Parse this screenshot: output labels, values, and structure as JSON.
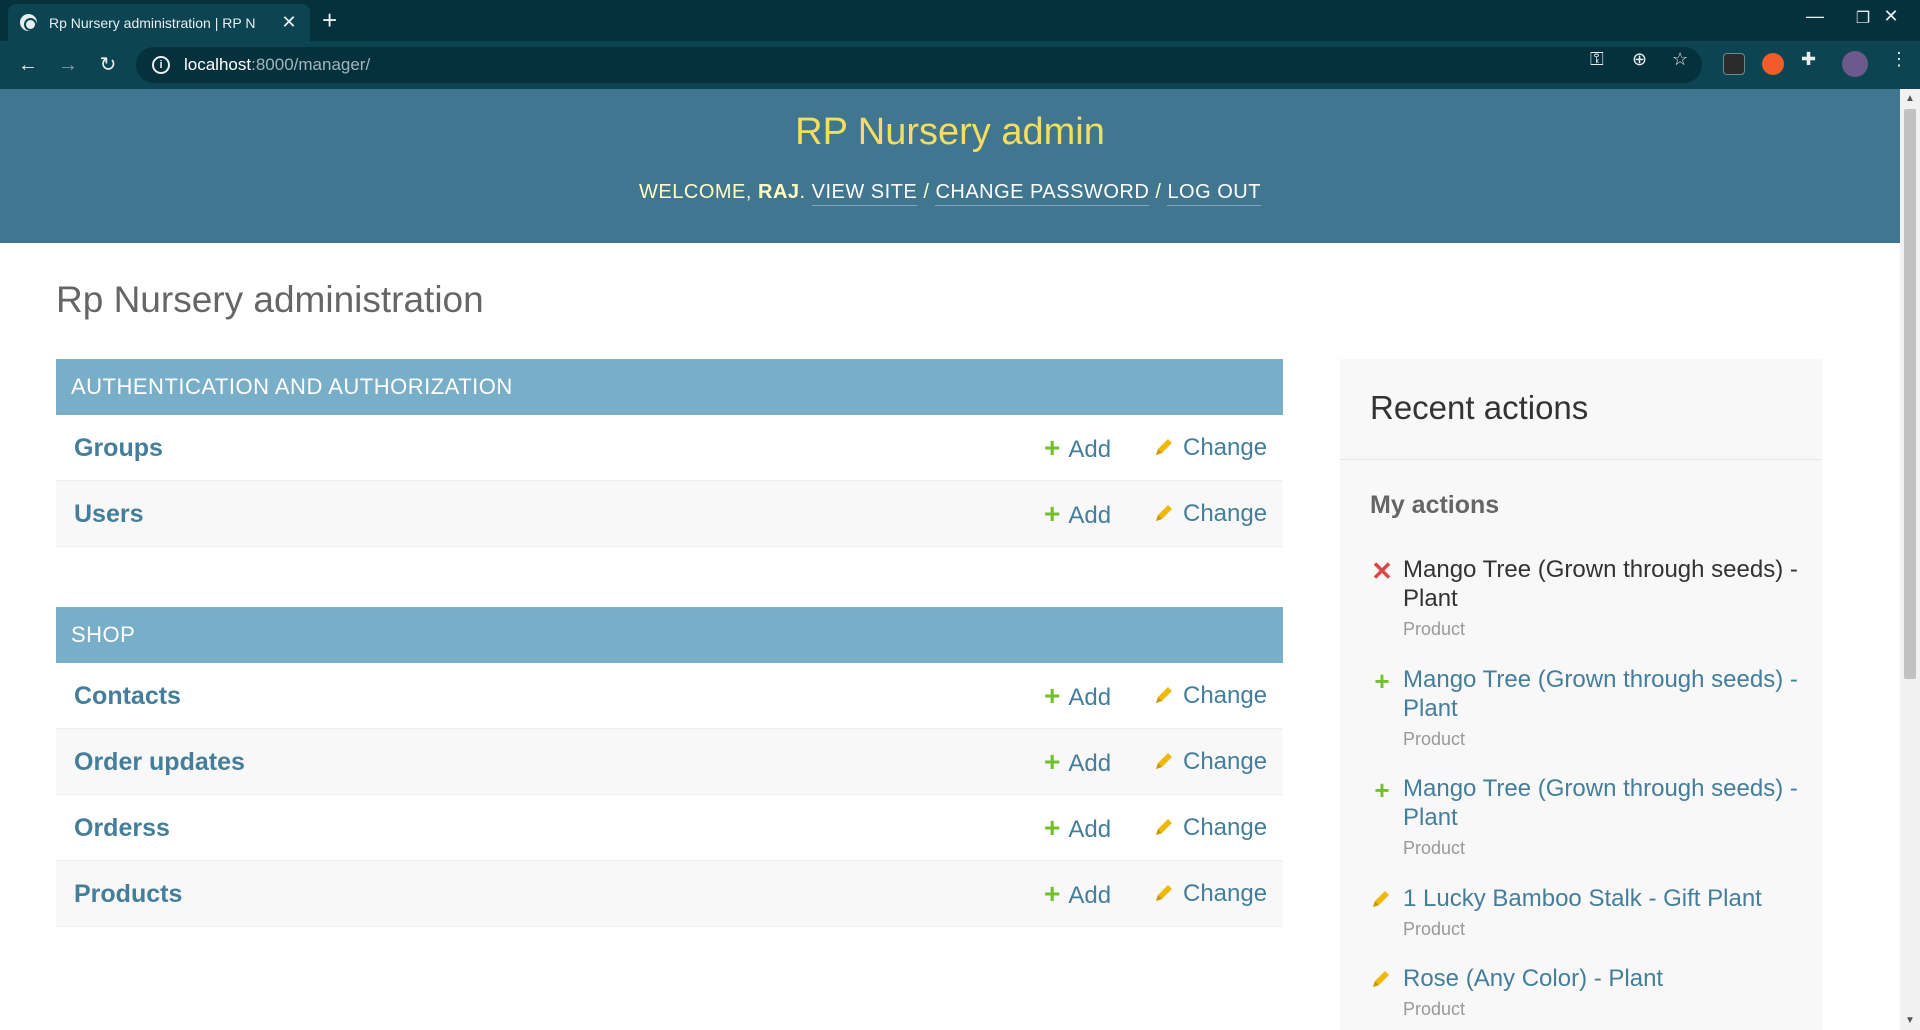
{
  "browser": {
    "tab_title": "Rp Nursery administration | RP N",
    "url_host": "localhost",
    "url_path": ":8000/manager/"
  },
  "header": {
    "brand": "RP Nursery admin",
    "welcome": "Welcome,",
    "username": "Raj",
    "view_site": "View site",
    "change_password": "Change password",
    "log_out": "Log out"
  },
  "page": {
    "title": "Rp Nursery administration"
  },
  "modules": [
    {
      "caption": "Authentication and Authorization",
      "rows": [
        {
          "name": "Groups",
          "add": "Add",
          "change": "Change"
        },
        {
          "name": "Users",
          "add": "Add",
          "change": "Change"
        }
      ]
    },
    {
      "caption": "Shop",
      "rows": [
        {
          "name": "Contacts",
          "add": "Add",
          "change": "Change"
        },
        {
          "name": "Order updates",
          "add": "Add",
          "change": "Change"
        },
        {
          "name": "Orderss",
          "add": "Add",
          "change": "Change"
        },
        {
          "name": "Products",
          "add": "Add",
          "change": "Change"
        }
      ]
    }
  ],
  "recent_actions": {
    "title": "Recent actions",
    "subtitle": "My actions",
    "items": [
      {
        "action": "deletion",
        "name": "Mango Tree (Grown through seeds) - Plant",
        "type": "Product"
      },
      {
        "action": "addition",
        "name": "Mango Tree (Grown through seeds) - Plant",
        "type": "Product"
      },
      {
        "action": "addition",
        "name": "Mango Tree (Grown through seeds) - Plant",
        "type": "Product"
      },
      {
        "action": "change",
        "name": "1 Lucky Bamboo Stalk - Gift Plant",
        "type": "Product"
      },
      {
        "action": "change",
        "name": "Rose (Any Color) - Plant",
        "type": "Product"
      }
    ]
  },
  "colors": {
    "header_bg": "#417690",
    "brand": "#f5dd5d",
    "module_caption_bg": "#79aec8",
    "link": "#447e9b",
    "add_green": "#70bf2b",
    "change_yellow": "#efb80b",
    "delete_red": "#dd4646"
  }
}
